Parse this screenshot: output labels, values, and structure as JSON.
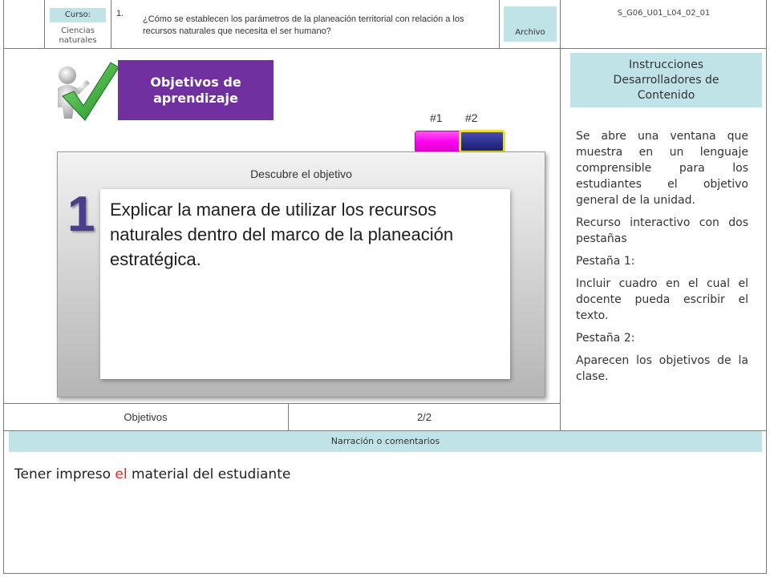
{
  "header": {
    "curso_label": "Curso:",
    "curso_value": "Ciencias naturales",
    "question_number": "1.",
    "question_text": "¿Cómo se establecen los parámetros de la planeación territorial con relación a los recursos naturales que necesita el ser humano?",
    "archivo_label": "Archivo",
    "code": "S_G06_U01_L04_02_01"
  },
  "banner": {
    "line1": "Objetivos de",
    "line2": "aprendizaje"
  },
  "tabs": [
    {
      "label": "#1",
      "color": "#ff00ee"
    },
    {
      "label": "#2",
      "color": "#2b2f8f"
    }
  ],
  "panel": {
    "title": "Descubre el objetivo",
    "number": "1",
    "text": "Explicar la manera de utilizar los recursos naturales dentro del marco de la planeación estratégica."
  },
  "instructions": {
    "header": "Instrucciones Desarrolladores de Contenido",
    "paragraphs": [
      "Se abre una ventana que muestra en un lenguaje comprensible para los estudiantes el objetivo general de la unidad.",
      "Recurso interactivo con dos pestañas",
      "Pestaña 1:",
      "Incluir cuadro en el cual el docente pueda escribir el texto.",
      "Pestaña 2:",
      "Aparecen los objetivos de la clase."
    ]
  },
  "footer": {
    "left": "Objetivos",
    "right": "2/2"
  },
  "narration": {
    "header": "Narración o comentarios",
    "text_before": "Tener impreso ",
    "text_highlight": "el",
    "text_after": " material del estudiante"
  },
  "colors": {
    "accent_purple": "#7030a0",
    "label_bg": "#bfe3e7",
    "number_color": "#4b3c8c"
  }
}
